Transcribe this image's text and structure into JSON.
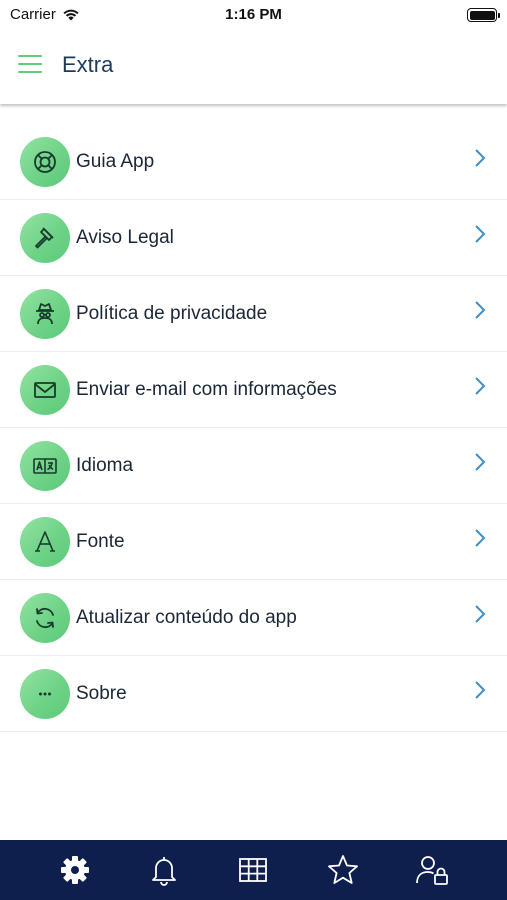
{
  "status_bar": {
    "carrier": "Carrier",
    "time": "1:16 PM"
  },
  "header": {
    "title": "Extra"
  },
  "menu": {
    "items": [
      {
        "label": "Guia App",
        "icon": "lifebuoy-icon"
      },
      {
        "label": "Aviso Legal",
        "icon": "gavel-icon"
      },
      {
        "label": "Política de privacidade",
        "icon": "spy-icon"
      },
      {
        "label": "Enviar e-mail com informações",
        "icon": "mail-icon"
      },
      {
        "label": "Idioma",
        "icon": "language-icon"
      },
      {
        "label": "Fonte",
        "icon": "font-icon"
      },
      {
        "label": "Atualizar conteúdo do app",
        "icon": "refresh-icon"
      },
      {
        "label": "Sobre",
        "icon": "more-icon"
      }
    ]
  },
  "tabbar": {
    "tabs": [
      {
        "icon": "gear-icon",
        "active": true
      },
      {
        "icon": "bell-icon",
        "active": false
      },
      {
        "icon": "grid-icon",
        "active": false
      },
      {
        "icon": "star-icon",
        "active": false
      },
      {
        "icon": "user-lock-icon",
        "active": false
      }
    ]
  },
  "colors": {
    "accent": "#5fcd7c",
    "title": "#1d3a5f",
    "tabbar": "#0e1f4e",
    "chevron": "#3f8fc7"
  }
}
